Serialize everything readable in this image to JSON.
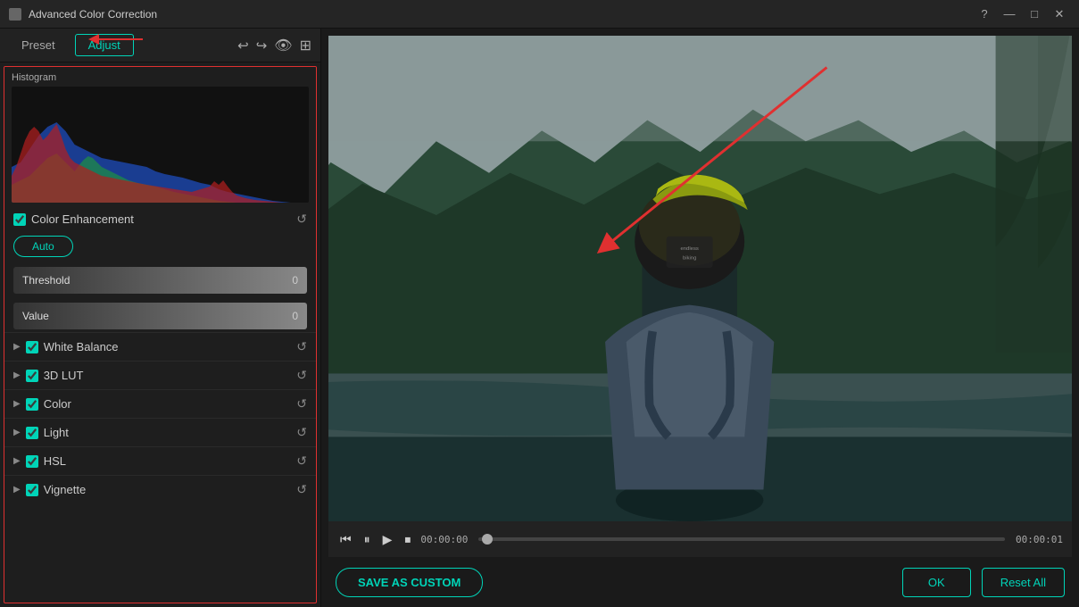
{
  "window": {
    "title": "Advanced Color Correction"
  },
  "tabs": {
    "preset_label": "Preset",
    "adjust_label": "Adjust"
  },
  "toolbar": {
    "undo_label": "↩",
    "redo_label": "↪"
  },
  "histogram": {
    "label": "Histogram"
  },
  "color_enhancement": {
    "label": "Color Enhancement",
    "auto_label": "Auto"
  },
  "sliders": {
    "threshold_label": "Threshold",
    "threshold_value": "0",
    "value_label": "Value",
    "value_value": "0"
  },
  "sections": [
    {
      "id": "white-balance",
      "label": "White Balance",
      "checked": true
    },
    {
      "id": "3d-lut",
      "label": "3D LUT",
      "checked": true
    },
    {
      "id": "color",
      "label": "Color",
      "checked": true
    },
    {
      "id": "light",
      "label": "Light",
      "checked": true
    },
    {
      "id": "hsl",
      "label": "HSL",
      "checked": true
    },
    {
      "id": "vignette",
      "label": "Vignette",
      "checked": true
    }
  ],
  "playback": {
    "time_start": "00:00:00",
    "time_end": "00:00:01"
  },
  "actions": {
    "save_as_custom": "SAVE AS CUSTOM",
    "ok": "OK",
    "reset_all": "Reset All"
  },
  "icons": {
    "help": "?",
    "minimize": "—",
    "maximize": "□",
    "close": "✕",
    "eye": "👁",
    "image": "⊞",
    "pause": "⏸",
    "play": "▶",
    "rewind": "⏮",
    "stop": "⏹",
    "reset": "↺"
  }
}
